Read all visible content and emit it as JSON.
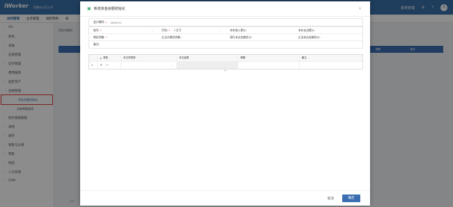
{
  "app": {
    "logo": "iWorker",
    "company": "智慧化示范公司",
    "user": "系统管理",
    "help_glyph": "?",
    "avatar_glyph": "人"
  },
  "subnav": [
    "协同管理",
    "业务管理",
    "组织架构",
    "权"
  ],
  "sidebar": {
    "items": [
      {
        "label": "OA",
        "arrow": "›"
      },
      {
        "label": "财务",
        "arrow": "⌄"
      },
      {
        "label": "总账",
        "arrow": "›"
      },
      {
        "label": "应收管理",
        "arrow": "›"
      },
      {
        "label": "应付管理",
        "arrow": "›"
      },
      {
        "label": "费用报销",
        "arrow": "›"
      },
      {
        "label": "固定资产",
        "arrow": "›"
      },
      {
        "label": "出纳管理",
        "arrow": "⌄"
      },
      {
        "label": "资金余额初始化"
      },
      {
        "label": "出纳单据查询"
      },
      {
        "label": "财务基础数据",
        "arrow": "›"
      },
      {
        "label": "采购",
        "arrow": "›"
      },
      {
        "label": "库存",
        "arrow": "›"
      },
      {
        "label": "销售与分销",
        "arrow": "›"
      },
      {
        "label": "零售",
        "arrow": "›"
      },
      {
        "label": "制造",
        "arrow": "›"
      },
      {
        "label": "人力资源",
        "arrow": "›"
      },
      {
        "label": "CRM",
        "arrow": "›"
      }
    ]
  },
  "background": {
    "tab": "资金余额初",
    "col_remark": "备注",
    "col_x": "摘要",
    "page_fragment": "100"
  },
  "modal": {
    "title": "新增资金余额初始化",
    "close": "×",
    "init_period_label": "会计期间:",
    "init_period_value": "2020-01",
    "row1": {
      "account": "账号:",
      "currency": "币别:",
      "currency_value": "人民币",
      "in_total": "本年收入累计:",
      "out_total": "本年支出累计:"
    },
    "row2": {
      "opening": "期初余额:",
      "ent_opening": "企业方期初余额:",
      "bank_diff": "银行未达金额合计:",
      "ent_diff": "企业未达金额合计:"
    },
    "row3": {
      "remark": "备注:"
    },
    "table": {
      "headers": [
        "类型",
        "未达项类型",
        "未达金额",
        "摘要",
        "备注"
      ],
      "row_index": "1"
    },
    "cancel": "取消",
    "ok": "确定"
  }
}
